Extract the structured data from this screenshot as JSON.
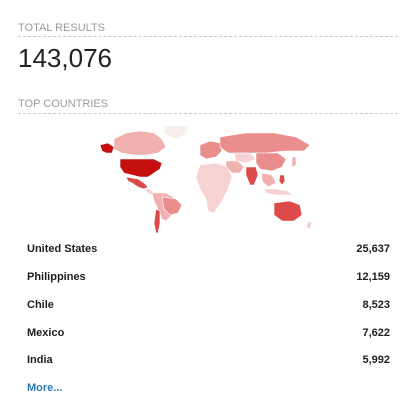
{
  "summary": {
    "total_label": "TOTAL RESULTS",
    "total_value": "143,076",
    "top_label": "TOP COUNTRIES"
  },
  "map": {
    "colors": {
      "darkest": "#c40f0f",
      "dark": "#de4a4a",
      "medium": "#ea8d8d",
      "light": "#f1b1b1",
      "lighter": "#f6d2d2",
      "none": "#f7eeee",
      "border": "#ffffff"
    }
  },
  "countries": [
    {
      "name": "United States",
      "count": "25,637"
    },
    {
      "name": "Philippines",
      "count": "12,159"
    },
    {
      "name": "Chile",
      "count": "8,523"
    },
    {
      "name": "Mexico",
      "count": "7,622"
    },
    {
      "name": "India",
      "count": "5,992"
    }
  ],
  "more_label": "More..."
}
